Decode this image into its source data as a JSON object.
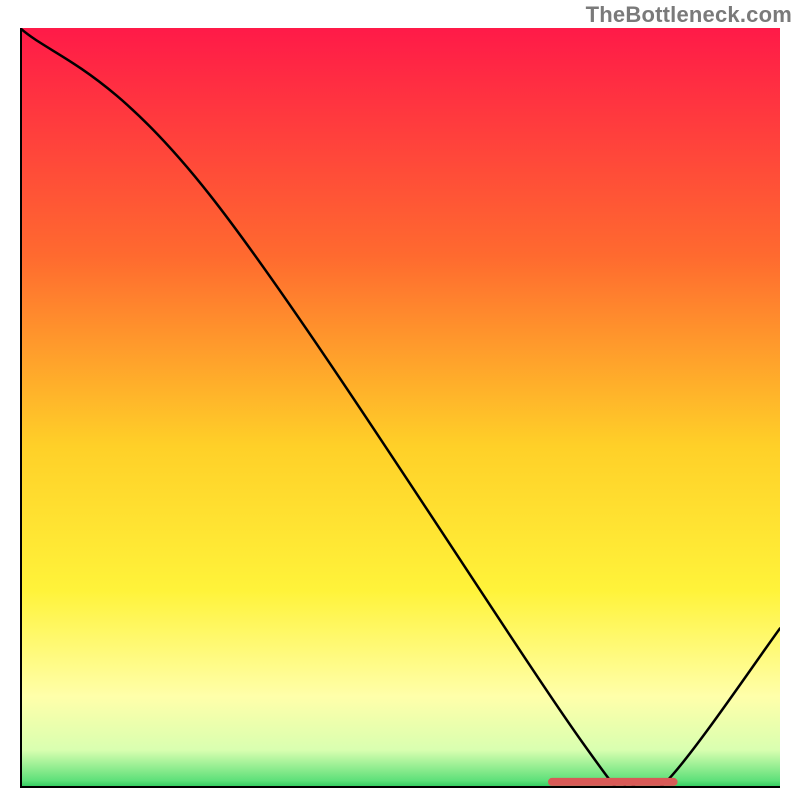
{
  "attribution": "TheBottleneck.com",
  "chart_data": {
    "type": "line",
    "title": "",
    "xlabel": "",
    "ylabel": "",
    "xlim": [
      0,
      100
    ],
    "ylim": [
      0,
      100
    ],
    "x": [
      0,
      25,
      74,
      80,
      85,
      100
    ],
    "values": [
      100,
      78,
      6,
      0.8,
      0.8,
      21
    ],
    "curve": "smooth",
    "line_color": "#000000",
    "line_width": 2.5,
    "background": {
      "type": "vertical-gradient",
      "stops": [
        {
          "offset": 0.0,
          "color": "#ff1a48"
        },
        {
          "offset": 0.3,
          "color": "#ff6a2f"
        },
        {
          "offset": 0.55,
          "color": "#ffd028"
        },
        {
          "offset": 0.74,
          "color": "#fff33a"
        },
        {
          "offset": 0.88,
          "color": "#ffffaa"
        },
        {
          "offset": 0.95,
          "color": "#d9ffb0"
        },
        {
          "offset": 0.99,
          "color": "#5fe07a"
        },
        {
          "offset": 1.0,
          "color": "#28c85a"
        }
      ]
    },
    "marker": {
      "type": "segment",
      "x0": 70,
      "x1": 86,
      "y": 0.8,
      "visible_text": "",
      "color": "#d85a57",
      "thickness": 8
    },
    "axes": {
      "left": true,
      "bottom": true,
      "right": false,
      "top": false,
      "color": "#000000",
      "thickness": 4
    }
  }
}
